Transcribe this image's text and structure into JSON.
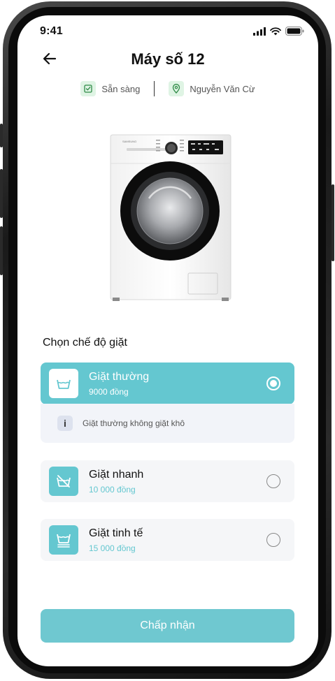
{
  "status_bar": {
    "time": "9:41"
  },
  "header": {
    "title": "Máy số 12"
  },
  "meta": {
    "status": "Sẵn sàng",
    "location": "Nguyễn Văn Cừ"
  },
  "section": {
    "title": "Chọn chế độ giặt"
  },
  "options": [
    {
      "name": "Giặt thường",
      "price": "9000 đồng",
      "selected": true,
      "icon": "wash-basin-icon"
    },
    {
      "name": "Giặt nhanh",
      "price": "10 000 đồng",
      "selected": false,
      "icon": "no-wash-icon"
    },
    {
      "name": "Giặt tinh tế",
      "price": "15 000 đồng",
      "selected": false,
      "icon": "delicate-wash-icon"
    }
  ],
  "info": {
    "badge": "i",
    "text": "Giặt thường không giặt khô"
  },
  "actions": {
    "accept_label": "Chấp nhận"
  },
  "colors": {
    "accent": "#64c7d0",
    "button": "#6fc8d0",
    "status_icon_bg": "#dff4e4"
  }
}
